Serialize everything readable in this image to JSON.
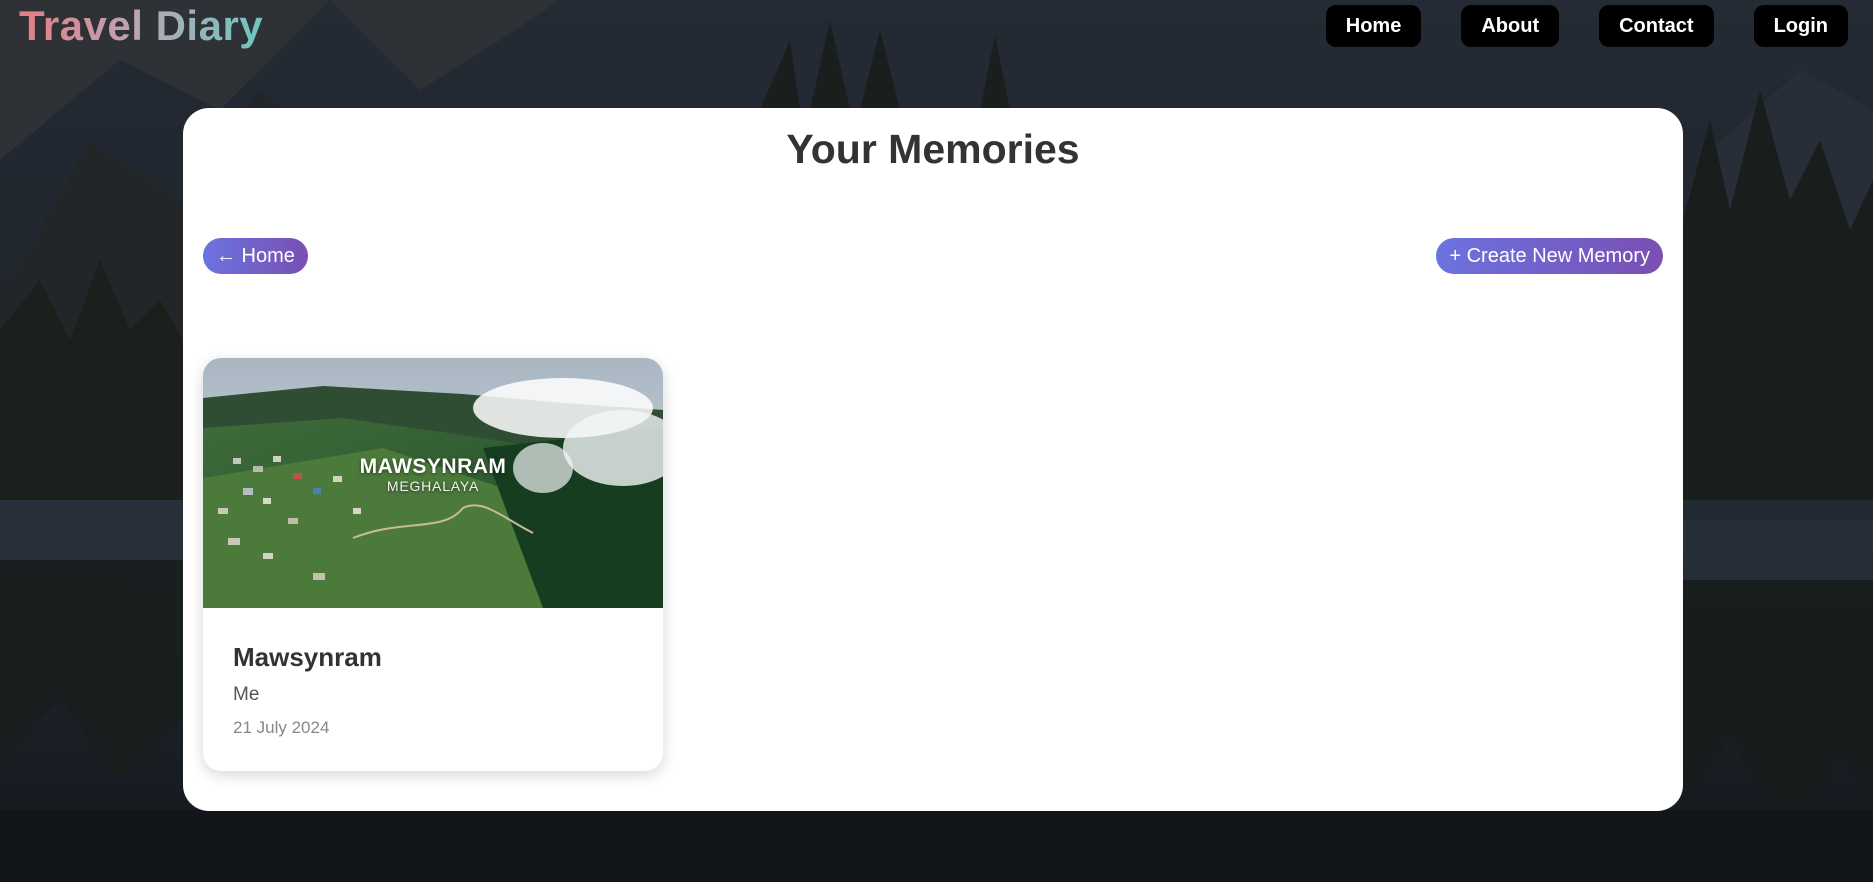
{
  "header": {
    "brand": "Travel Diary",
    "nav": [
      "Home",
      "About",
      "Contact",
      "Login"
    ]
  },
  "main": {
    "title": "Your Memories",
    "back_button": "← Home",
    "create_button": "+ Create New Memory",
    "memories": [
      {
        "image_title": "MAWSYNRAM",
        "image_subtitle": "MEGHALAYA",
        "title": "Mawsynram",
        "author": "Me",
        "date": "21 July 2024"
      }
    ]
  },
  "colors": {
    "accent_start": "#6b73e0",
    "accent_end": "#7a4fb2",
    "nav_bg": "#000000",
    "panel_bg": "#ffffff"
  },
  "icons": {
    "back": "left-arrow-icon"
  }
}
